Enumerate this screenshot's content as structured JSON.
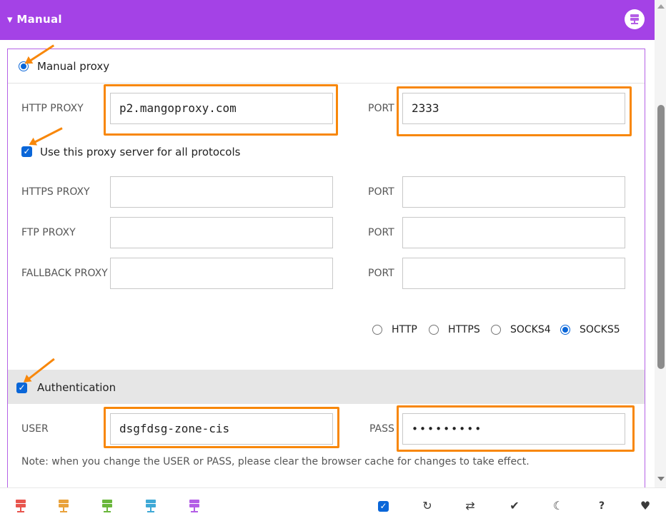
{
  "header": {
    "title": "▾ Manual",
    "icon": "server-icon",
    "color": "#a442e6"
  },
  "manual": {
    "radio_label": "Manual proxy",
    "selected": true
  },
  "http": {
    "label": "HTTP PROXY",
    "value": "p2.mangoproxy.com",
    "port_label": "PORT",
    "port_value": "2333"
  },
  "all_protocols": {
    "label": "Use this proxy server for all protocols",
    "checked": true
  },
  "https": {
    "label": "HTTPS PROXY",
    "value": "",
    "port_label": "PORT",
    "port_value": ""
  },
  "ftp": {
    "label": "FTP PROXY",
    "value": "",
    "port_label": "PORT",
    "port_value": ""
  },
  "fallback": {
    "label": "FALLBACK PROXY",
    "value": "",
    "port_label": "PORT",
    "port_value": ""
  },
  "protocols": {
    "options": [
      "HTTP",
      "HTTPS",
      "SOCKS4",
      "SOCKS5"
    ],
    "selected": "SOCKS5"
  },
  "auth": {
    "label": "Authentication",
    "checked": true,
    "user_label": "USER",
    "user_value": "dsgfdsg-zone-cis",
    "pass_label": "PASS",
    "pass_value": "•••••••••",
    "note": "Note: when you change the USER or PASS, please clear the browser cache for changes to take effect."
  },
  "colors": {
    "accent": "#a442e6",
    "highlight": "#f8870a",
    "checkbox": "#0a66d8"
  },
  "bottom_bar": {
    "server_icons": [
      {
        "name": "server-icon-red",
        "color": "#e8554e"
      },
      {
        "name": "server-icon-orange",
        "color": "#e9a23b"
      },
      {
        "name": "server-icon-green",
        "color": "#6ab73c"
      },
      {
        "name": "server-icon-blue",
        "color": "#3fa9d6"
      },
      {
        "name": "server-icon-purple",
        "color": "#b45ee6"
      }
    ],
    "tools": [
      {
        "name": "checkbox-icon",
        "glyph": "✓"
      },
      {
        "name": "refresh-icon",
        "glyph": "↻"
      },
      {
        "name": "repeat-icon",
        "glyph": "⇄"
      },
      {
        "name": "check-icon",
        "glyph": "✔"
      },
      {
        "name": "moon-icon",
        "glyph": "☾"
      },
      {
        "name": "help-icon",
        "glyph": "?"
      },
      {
        "name": "heart-icon",
        "glyph": "♥"
      }
    ]
  }
}
